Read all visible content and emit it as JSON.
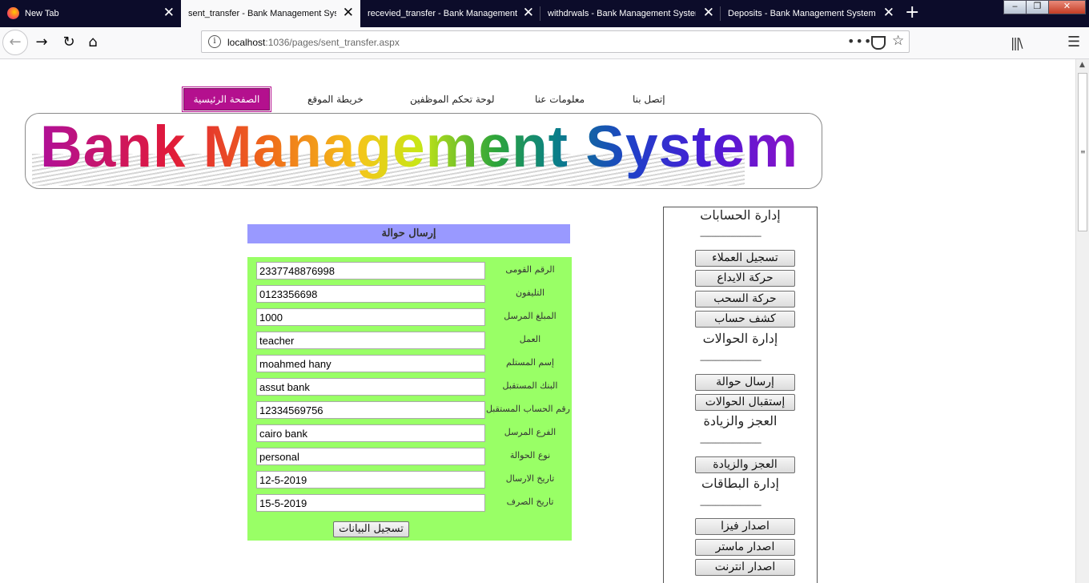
{
  "browser": {
    "tabs": [
      {
        "title": "New Tab"
      },
      {
        "title": "sent_transfer - Bank Management System"
      },
      {
        "title": "recevied_transfer - Bank Management System"
      },
      {
        "title": "withdrwals - Bank Management System"
      },
      {
        "title": "Deposits - Bank Management System"
      }
    ],
    "active_tab": 1,
    "url_host": "localhost",
    "url_path": ":1036/pages/sent_transfer.aspx"
  },
  "nav": {
    "home": "الصفحة الرئيسية",
    "sitemap": "خريطة الموقع",
    "dashboard": "لوحة تحكم الموظفين",
    "about": "معلومات عنا",
    "contact": "إتصل بنا"
  },
  "banner": {
    "text": "Bank Management System"
  },
  "side": {
    "divider": "--------------------------------",
    "sections": [
      {
        "title": "إدارة الحسابات",
        "buttons": [
          "تسجيل العملاء",
          "حركة الايداع",
          "حركة السحب",
          "كشف حساب"
        ]
      },
      {
        "title": "إدارة الحوالات",
        "buttons": [
          "إرسال حوالة",
          "إستقبال الحوالات"
        ]
      },
      {
        "title": "العجز والزيادة",
        "buttons": [
          "العجز والزيادة"
        ]
      },
      {
        "title": "إدارة البطاقات",
        "buttons": [
          "اصدار فيزا",
          "اصدار ماستر",
          "اصدار انترنت"
        ]
      }
    ]
  },
  "form": {
    "title": "إرسال حوالة",
    "fields": [
      {
        "label": "الرقم القومى",
        "value": "2337748876998"
      },
      {
        "label": "التليفون",
        "value": "0123356698"
      },
      {
        "label": "المبلغ المرسل",
        "value": "1000"
      },
      {
        "label": "العمل",
        "value": "teacher"
      },
      {
        "label": "إسم المستلم",
        "value": "moahmed hany"
      },
      {
        "label": "البنك المستقبل",
        "value": "assut bank"
      },
      {
        "label": "رقم الحساب المستقبل",
        "value": "12334569756"
      },
      {
        "label": "الفرع المرسل",
        "value": "cairo bank"
      },
      {
        "label": "نوع الحوالة",
        "value": "personal"
      },
      {
        "label": "تاريخ الارسال",
        "value": "12-5-2019"
      },
      {
        "label": "تاريخ الصرف",
        "value": "15-5-2019"
      }
    ],
    "submit": "تسجيل البيانات"
  }
}
